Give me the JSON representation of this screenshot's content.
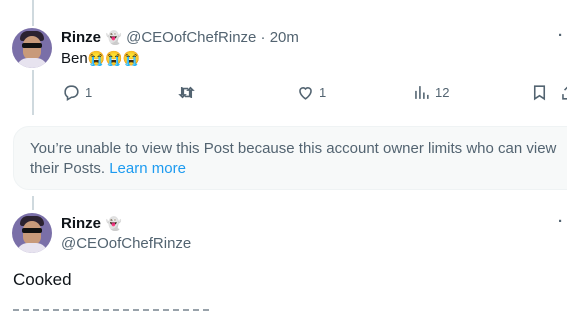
{
  "reply": {
    "name": "Rinze",
    "badge": "👻",
    "handle_time": "@CEOofChefRinze · 20m",
    "text": "Ben",
    "emojis": "😭😭😭",
    "more": "·",
    "actions": {
      "replies": "1",
      "retweets": "",
      "likes": "1",
      "views": "12"
    }
  },
  "notice": {
    "text": "You’re unable to view this Post because this account owner limits who can view their Posts. ",
    "link": "Learn more"
  },
  "main_post": {
    "name": "Rinze",
    "badge": "👻",
    "handle": "@CEOofChefRinze",
    "more": "·",
    "text": "Cooked"
  },
  "colors": {
    "accent": "#1d9bf0",
    "muted": "#536471",
    "line": "#cfd9de"
  }
}
